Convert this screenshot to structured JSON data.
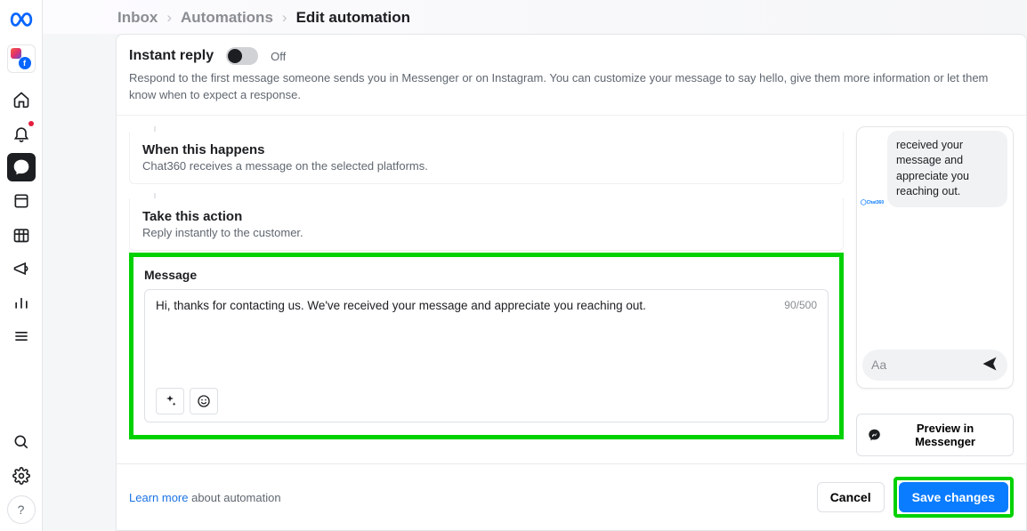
{
  "breadcrumb": {
    "inbox": "Inbox",
    "automations": "Automations",
    "current": "Edit automation"
  },
  "header": {
    "title": "Instant reply",
    "toggle_state": "Off",
    "description": "Respond to the first message someone sends you in Messenger or on Instagram. You can customize your message to say hello, give them more information or let them know when to expect a response."
  },
  "sections": {
    "when": {
      "title": "When this happens",
      "sub": "Chat360 receives a message on the selected platforms."
    },
    "action": {
      "title": "Take this action",
      "sub": "Reply instantly to the customer."
    }
  },
  "message": {
    "label": "Message",
    "value": "Hi, thanks for contacting us. We've received your message and appreciate you reaching out.",
    "char_count": "90/500"
  },
  "preview": {
    "avatar_label": "Chat360",
    "bubble_text": "received your message and appreciate you reaching out.",
    "composer_placeholder": "Aa",
    "button": "Preview in Messenger"
  },
  "footer": {
    "learn_link": "Learn more",
    "learn_rest": " about automation",
    "cancel": "Cancel",
    "save": "Save changes"
  }
}
